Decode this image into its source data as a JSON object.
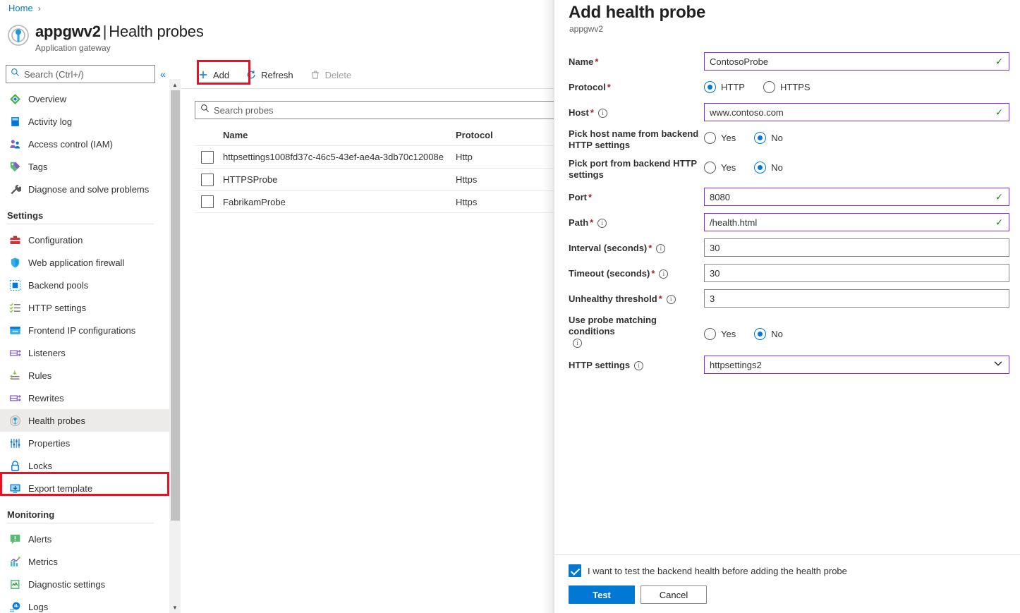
{
  "breadcrumb": {
    "home": "Home",
    "separator": "›"
  },
  "header": {
    "resource_name": "appgwv2",
    "separator": "|",
    "page_name": "Health probes",
    "resource_type": "Application gateway"
  },
  "sidebar": {
    "search_placeholder": "Search (Ctrl+/)",
    "collapse_glyph": "«",
    "items": [
      {
        "label": "Overview",
        "icon": "overview-icon"
      },
      {
        "label": "Activity log",
        "icon": "activity-log-icon"
      },
      {
        "label": "Access control (IAM)",
        "icon": "access-control-icon"
      },
      {
        "label": "Tags",
        "icon": "tags-icon"
      },
      {
        "label": "Diagnose and solve problems",
        "icon": "wrench-icon"
      }
    ],
    "settings_group": "Settings",
    "settings_items": [
      {
        "label": "Configuration",
        "icon": "configuration-icon"
      },
      {
        "label": "Web application firewall",
        "icon": "shield-icon"
      },
      {
        "label": "Backend pools",
        "icon": "backend-pools-icon"
      },
      {
        "label": "HTTP settings",
        "icon": "http-settings-icon"
      },
      {
        "label": "Frontend IP configurations",
        "icon": "frontend-ip-icon"
      },
      {
        "label": "Listeners",
        "icon": "listeners-icon"
      },
      {
        "label": "Rules",
        "icon": "rules-icon"
      },
      {
        "label": "Rewrites",
        "icon": "rewrites-icon"
      },
      {
        "label": "Health probes",
        "icon": "health-probe-icon",
        "selected": true
      },
      {
        "label": "Properties",
        "icon": "properties-icon"
      },
      {
        "label": "Locks",
        "icon": "lock-icon"
      },
      {
        "label": "Export template",
        "icon": "export-template-icon"
      }
    ],
    "monitoring_group": "Monitoring",
    "monitoring_items": [
      {
        "label": "Alerts",
        "icon": "alerts-icon"
      },
      {
        "label": "Metrics",
        "icon": "metrics-icon"
      },
      {
        "label": "Diagnostic settings",
        "icon": "diagnostic-settings-icon"
      },
      {
        "label": "Logs",
        "icon": "logs-icon"
      }
    ]
  },
  "command_bar": {
    "add_label": "Add",
    "refresh_label": "Refresh",
    "delete_label": "Delete"
  },
  "list": {
    "search_placeholder": "Search probes",
    "columns": [
      "Name",
      "Protocol"
    ],
    "rows": [
      {
        "name": "httpsettings1008fd37c-46c5-43ef-ae4a-3db70c12008e",
        "protocol": "Http"
      },
      {
        "name": "HTTPSProbe",
        "protocol": "Https"
      },
      {
        "name": "FabrikamProbe",
        "protocol": "Https"
      }
    ]
  },
  "panel": {
    "title": "Add health probe",
    "subtitle": "appgwv2",
    "fields": {
      "name": {
        "label": "Name",
        "value": "ContosoProbe",
        "required": true
      },
      "protocol": {
        "label": "Protocol",
        "required": true,
        "options": [
          "HTTP",
          "HTTPS"
        ],
        "selected": "HTTP"
      },
      "host": {
        "label": "Host",
        "value": "www.contoso.com",
        "required": true,
        "has_info": true
      },
      "pick_host": {
        "label": "Pick host name from backend HTTP settings",
        "options": [
          "Yes",
          "No"
        ],
        "selected": "No"
      },
      "pick_port": {
        "label": "Pick port from backend HTTP settings",
        "options": [
          "Yes",
          "No"
        ],
        "selected": "No"
      },
      "port": {
        "label": "Port",
        "value": "8080",
        "required": true
      },
      "path": {
        "label": "Path",
        "value": "/health.html",
        "required": true,
        "has_info": true
      },
      "interval": {
        "label": "Interval (seconds)",
        "value": "30",
        "required": true,
        "has_info": true
      },
      "timeout": {
        "label": "Timeout (seconds)",
        "value": "30",
        "required": true,
        "has_info": true
      },
      "unhealthy_threshold": {
        "label": "Unhealthy threshold",
        "value": "3",
        "required": true,
        "has_info": true
      },
      "probe_matching": {
        "label": "Use probe matching conditions",
        "options": [
          "Yes",
          "No"
        ],
        "selected": "No",
        "has_info": true
      },
      "http_settings": {
        "label": "HTTP settings",
        "value": "httpsettings2",
        "has_info": true
      }
    },
    "footer": {
      "checkbox_label": "I want to test the backend health before adding the health probe",
      "checkbox_checked": true,
      "test_label": "Test",
      "cancel_label": "Cancel"
    }
  },
  "colors": {
    "accent": "#0078d4",
    "highlight_red": "#e81123",
    "valid_border": "#8a2be2",
    "check_green": "#107c10",
    "required_red": "#a4262c"
  }
}
